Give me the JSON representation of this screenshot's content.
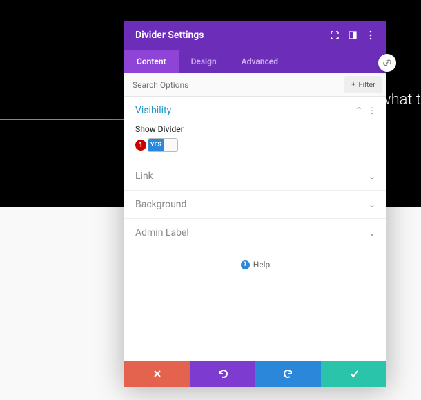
{
  "background": {
    "text_fragment": "e what t"
  },
  "modal": {
    "title": "Divider Settings",
    "tabs": {
      "content": "Content",
      "design": "Design",
      "advanced": "Advanced"
    },
    "search": {
      "placeholder": "Search Options",
      "filter_label": "Filter"
    },
    "sections": {
      "visibility": {
        "title": "Visibility",
        "option_label": "Show Divider",
        "toggle_on_label": "YES",
        "step_marker": "1"
      },
      "link": {
        "title": "Link"
      },
      "background": {
        "title": "Background"
      },
      "admin_label": {
        "title": "Admin Label"
      }
    },
    "help_label": "Help"
  }
}
